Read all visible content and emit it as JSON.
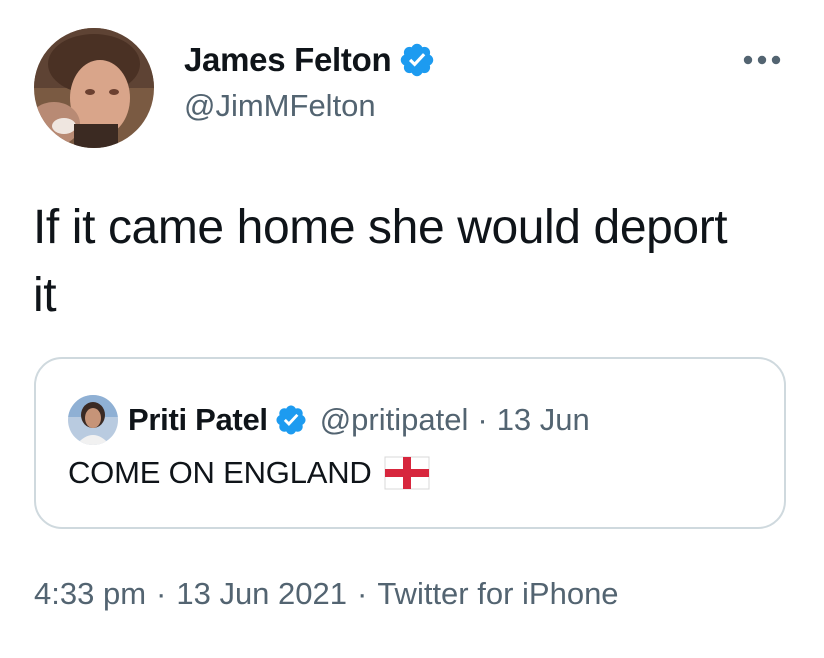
{
  "author": {
    "display_name": "James Felton",
    "handle": "@JimMFelton",
    "verified": true,
    "avatar_icon": "profile-photo"
  },
  "more_icon": "ellipsis-icon",
  "tweet": {
    "text": "If it came home she would deport it"
  },
  "quoted_tweet": {
    "display_name": "Priti Patel",
    "handle": "@pritipatel",
    "separator": "·",
    "date": "13 Jun",
    "text": "COME ON ENGLAND",
    "emoji_icon": "england-flag-icon"
  },
  "meta": {
    "time": "4:33 pm",
    "separator": "·",
    "date": "13 Jun 2021",
    "source": "Twitter for iPhone"
  },
  "colors": {
    "text_primary": "#0f1419",
    "text_secondary": "#536471",
    "verified_blue": "#1d9bf0",
    "border": "#cfd9de"
  }
}
